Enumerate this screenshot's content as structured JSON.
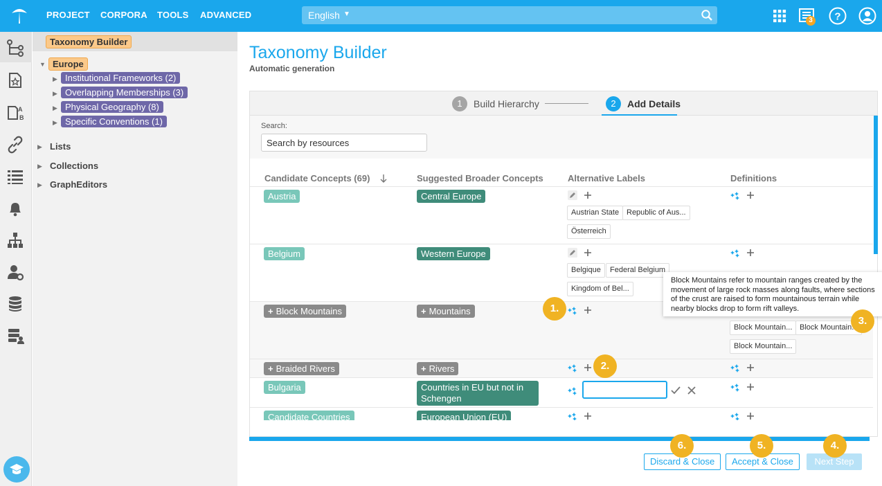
{
  "topbar": {
    "menu": [
      "PROJECT",
      "CORPORA",
      "TOOLS",
      "ADVANCED"
    ],
    "search_value": "English",
    "notification_count": "3",
    "icons": [
      "app-grid-icon",
      "notifications-icon",
      "help-icon",
      "user-icon"
    ],
    "color": "#1aa7ec"
  },
  "rail_icons": [
    "hierarchy-icon",
    "document-star-icon",
    "language-ab-icon",
    "link-icon",
    "list-icon",
    "bell-icon",
    "org-chart-icon",
    "user-settings-icon",
    "database-icon",
    "server-user-icon",
    "education-cap-icon"
  ],
  "tree": {
    "title": "Taxonomy Builder",
    "root": "Europe",
    "children": [
      "Institutional Frameworks (2)",
      "Overlapping Memberships (3)",
      "Physical Geography (8)",
      "Specific Conventions (1)"
    ],
    "sections": [
      "Lists",
      "Collections",
      "GraphEditors"
    ]
  },
  "main": {
    "title": "Taxonomy Builder",
    "subtitle": "Automatic generation",
    "steps": [
      {
        "num": "1",
        "label": "Build Hierarchy"
      },
      {
        "num": "2",
        "label": "Add Details"
      }
    ],
    "search_label": "Search:",
    "search_placeholder": "Search by resources",
    "columns": [
      "Candidate Concepts (69)",
      "Suggested Broader Concepts",
      "Alternative Labels",
      "Definitions"
    ],
    "rows": [
      {
        "concept": "Austria",
        "broader": "Central Europe",
        "labels": [
          "Austrian State",
          "Republic of Aus...",
          "Österreich"
        ]
      },
      {
        "concept": "Belgium",
        "broader": "Western Europe",
        "labels": [
          "Belgique",
          "Federal Belgium",
          "Kingdom of Bel..."
        ]
      },
      {
        "concept": "Block Mountains",
        "broader": "Mountains",
        "definitions": [
          "Block Mountain...",
          "Block Mountain...",
          "Block Mountain..."
        ]
      },
      {
        "concept": "Braided Rivers",
        "broader": "Rivers"
      },
      {
        "concept": "Bulgaria",
        "broader": "Countries in EU but not in Schengen"
      },
      {
        "concept": "Candidate Countries",
        "broader": "European Union (EU)"
      }
    ],
    "tooltip": "Block Mountains refer to mountain ranges created by the movement of large rock masses along faults, where sections of the crust are raised to form mountainous terrain while nearby blocks drop to form rift valleys."
  },
  "buttons": {
    "discard": "Discard & Close",
    "accept": "Accept & Close",
    "next": "Next Step"
  },
  "markers": [
    "1.",
    "2.",
    "3.",
    "4.",
    "5.",
    "6."
  ]
}
